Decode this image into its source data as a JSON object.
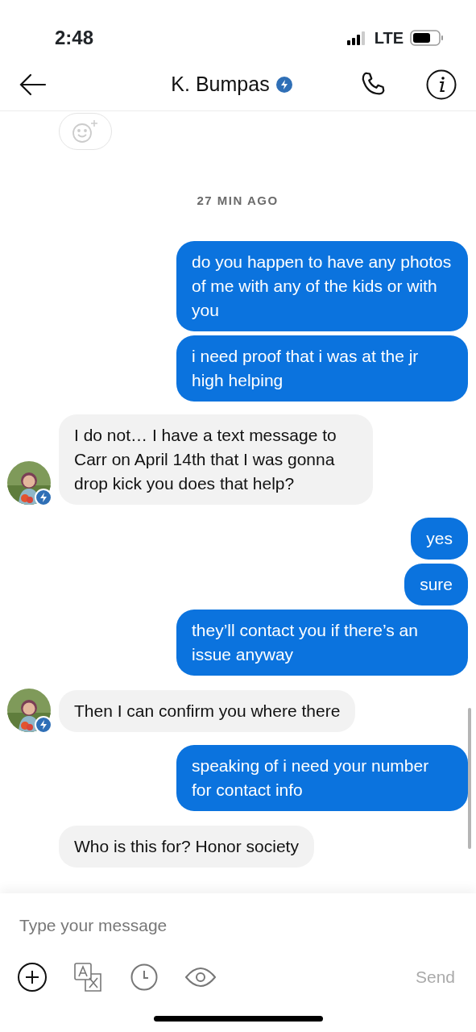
{
  "status_bar": {
    "time": "2:48",
    "network": "LTE"
  },
  "header": {
    "name": "K. Bumpas",
    "verified": true
  },
  "timestamp": "27 MIN AGO",
  "messages": [
    {
      "kind": "sent",
      "text": "do you happen to have any photos of me with any of the kids or with you"
    },
    {
      "kind": "sent",
      "text": "i need proof that i was at the jr high helping"
    },
    {
      "kind": "received",
      "text": "I do not… I have a text message to Carr on April 14th that I was gonna drop kick you does that help?",
      "avatar": true
    },
    {
      "kind": "sent",
      "text": "yes"
    },
    {
      "kind": "sent",
      "text": "sure"
    },
    {
      "kind": "sent",
      "text": "they’ll contact you if there’s an issue anyway"
    },
    {
      "kind": "received",
      "text": "Then I can confirm you where there",
      "avatar": true
    },
    {
      "kind": "sent",
      "text": "speaking of i need your number for contact info"
    },
    {
      "kind": "received",
      "text": "Who is this for? Honor society",
      "avatar": false
    }
  ],
  "composer": {
    "placeholder": "Type your message",
    "send": "Send"
  }
}
